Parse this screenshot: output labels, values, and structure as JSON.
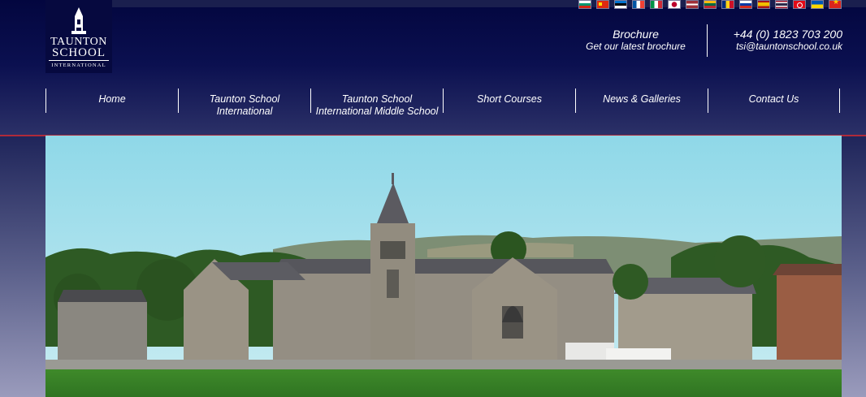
{
  "logo": {
    "line1": "TAUNTON",
    "line2": "SCHOOL",
    "line3": "INTERNATIONAL"
  },
  "flags": [
    "bulgaria-flag",
    "china-flag",
    "estonia-flag",
    "france-flag",
    "italy-flag",
    "japan-flag",
    "latvia-flag",
    "lithuania-flag",
    "romania-flag",
    "russia-flag",
    "spain-flag",
    "thailand-flag",
    "turkey-flag",
    "ukraine-flag",
    "vietnam-flag"
  ],
  "brochure": {
    "title": "Brochure",
    "subtitle": "Get our latest brochure"
  },
  "contact": {
    "phone": "+44 (0) 1823 703 200",
    "email": "tsi@tauntonschool.co.uk"
  },
  "nav": [
    {
      "line1": "Home",
      "line2": ""
    },
    {
      "line1": "Taunton School",
      "line2": "International"
    },
    {
      "line1": "Taunton School",
      "line2": "International Middle School"
    },
    {
      "line1": "Short Courses",
      "line2": ""
    },
    {
      "line1": "News & Galleries",
      "line2": ""
    },
    {
      "line1": "Contact Us",
      "line2": ""
    }
  ],
  "colors": {
    "header_bg": "#03063f",
    "accent_line": "#b02a3a",
    "text": "#ffffff"
  }
}
